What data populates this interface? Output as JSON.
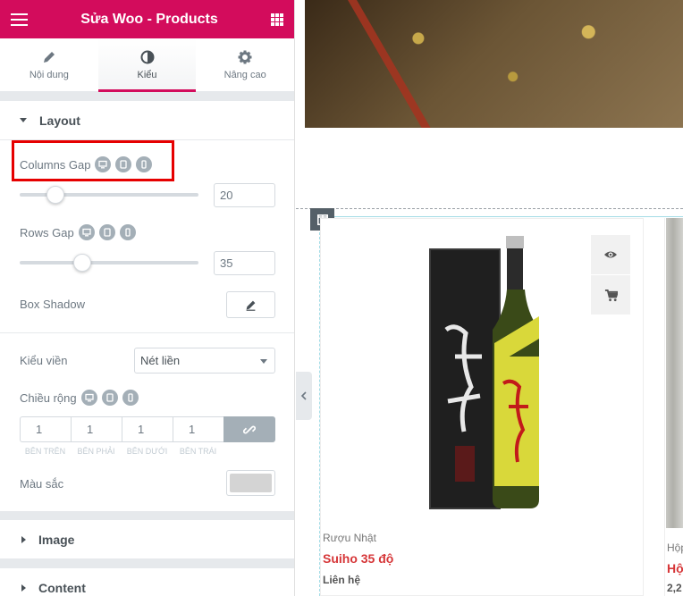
{
  "header": {
    "title": "Sửa Woo - Products"
  },
  "tabs": [
    {
      "label": "Nội dung",
      "icon": "pencil-icon"
    },
    {
      "label": "Kiểu",
      "icon": "half-circle-icon",
      "active": true
    },
    {
      "label": "Nâng cao",
      "icon": "gear-icon"
    }
  ],
  "layout": {
    "title": "Layout",
    "columns_gap": {
      "label": "Columns Gap",
      "value": "20",
      "fraction": 0.2
    },
    "rows_gap": {
      "label": "Rows Gap",
      "value": "35",
      "fraction": 0.35
    },
    "box_shadow": {
      "label": "Box Shadow"
    },
    "border_type": {
      "label": "Kiểu viền",
      "value": "Nét liền"
    },
    "border_width": {
      "label": "Chiều rộng",
      "values": [
        "1",
        "1",
        "1",
        "1"
      ],
      "sides": [
        "BÊN TRÊN",
        "BÊN PHẢI",
        "BÊN DƯỚI",
        "BÊN TRÁI"
      ]
    },
    "border_color": {
      "label": "Màu sắc",
      "value": "#d4d4d4"
    }
  },
  "sections": {
    "image": "Image",
    "content": "Content"
  },
  "preview": {
    "product1": {
      "category": "Rượu Nhật",
      "name": "Suiho 35 độ",
      "price": "Liên hệ"
    },
    "product2": {
      "category": "Hộp",
      "name": "Hộ",
      "price": "2,2"
    }
  },
  "colors": {
    "brand": "#d30c5c",
    "sale": "#d63638"
  }
}
